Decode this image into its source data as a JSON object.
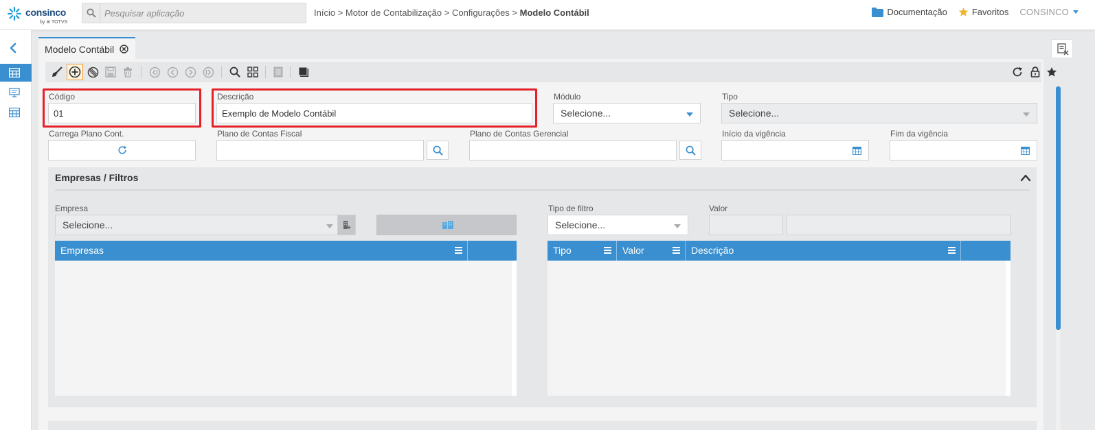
{
  "header": {
    "brand": "consinco",
    "brand_sub": "by ⊗ TOTVS",
    "search_placeholder": "Pesquisar aplicação",
    "breadcrumb": [
      "Início",
      "Motor de Contabilização",
      "Configurações"
    ],
    "breadcrumb_current": "Modelo Contábil",
    "breadcrumb_sep": ">",
    "docs_label": "Documentação",
    "favorites_label": "Favoritos",
    "user_label": "CONSINCO"
  },
  "tab": {
    "label": "Modelo Contábil"
  },
  "form": {
    "codigo_label": "Código",
    "codigo_value": "01",
    "descricao_label": "Descrição",
    "descricao_value": "Exemplo de Modelo Contábil",
    "modulo_label": "Módulo",
    "modulo_value": "Selecione...",
    "tipo_label": "Tipo",
    "tipo_value": "Selecione...",
    "carrega_label": "Carrega Plano Cont.",
    "plano_fiscal_label": "Plano de Contas Fiscal",
    "plano_fiscal_value": "",
    "plano_gerencial_label": "Plano de Contas Gerencial",
    "plano_gerencial_value": "",
    "inicio_label": "Início da vigência",
    "inicio_value": "",
    "fim_label": "Fim da vigência",
    "fim_value": ""
  },
  "section": {
    "title": "Empresas / Filtros",
    "empresa_label": "Empresa",
    "empresa_value": "Selecione...",
    "tipo_filtro_label": "Tipo de filtro",
    "tipo_filtro_value": "Selecione...",
    "valor_label": "Valor",
    "grid_empresas": {
      "columns": [
        "Empresas"
      ]
    },
    "grid_filtros": {
      "columns": [
        "Tipo",
        "Valor",
        "Descrição"
      ]
    }
  },
  "colors": {
    "accent": "#3a8fd0",
    "highlight": "#e32127",
    "star": "#f0b429"
  }
}
